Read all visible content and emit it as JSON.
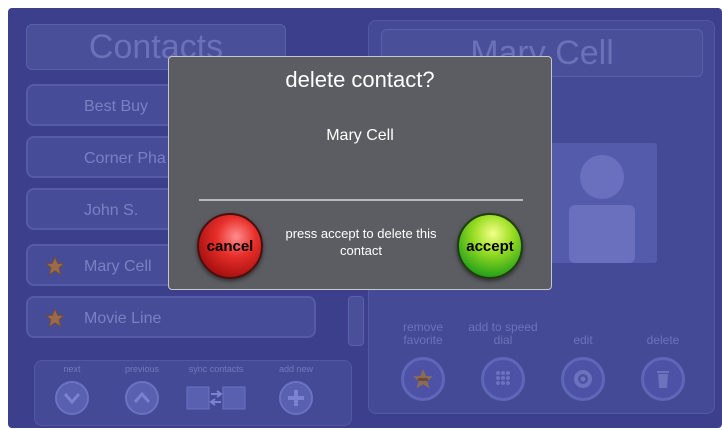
{
  "contacts_panel": {
    "header": "Contacts",
    "items": [
      {
        "label": "Best Buy",
        "favorite": false
      },
      {
        "label": "Corner Pha",
        "favorite": false
      },
      {
        "label": "John S.",
        "favorite": false
      },
      {
        "label": "Mary Cell",
        "favorite": true
      },
      {
        "label": "Movie Line",
        "favorite": true
      }
    ],
    "toolbar": {
      "next": "next",
      "previous": "previous",
      "sync": "sync contacts",
      "add_new": "add new"
    }
  },
  "detail_panel": {
    "name": "Mary Cell",
    "actions": {
      "remove_favorite": "remove favorite",
      "speed_dial": "add to speed dial",
      "edit": "edit",
      "delete": "delete"
    }
  },
  "dialog": {
    "title": "delete contact?",
    "contact_name": "Mary Cell",
    "message": "press accept to delete this contact",
    "cancel_label": "cancel",
    "accept_label": "accept"
  },
  "colors": {
    "background": "#3c3f8c",
    "dialog": "#5c5d62",
    "cancel": "#d82620",
    "accept": "#5cc41e"
  },
  "icons": [
    "star-icon",
    "chevron-down-icon",
    "chevron-up-icon",
    "sync-icon",
    "plus-icon",
    "remove-favorite-icon",
    "keypad-icon",
    "gear-icon",
    "trash-icon",
    "person-icon"
  ]
}
